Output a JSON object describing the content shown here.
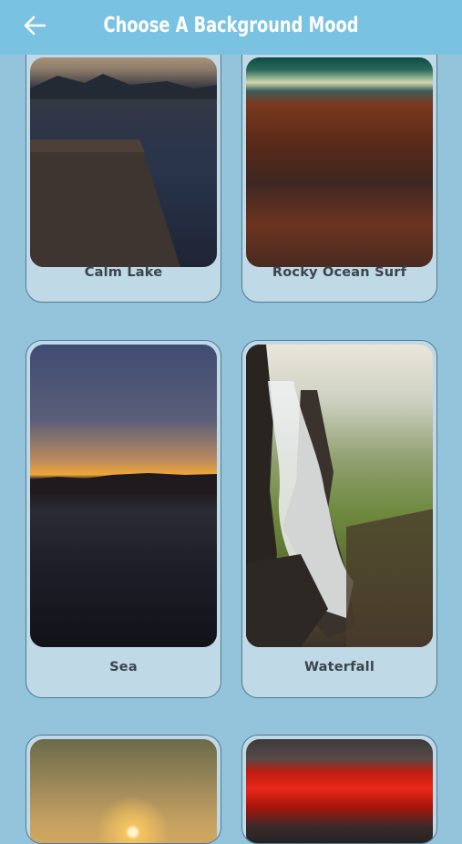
{
  "header": {
    "title": "Choose A Background Mood",
    "back_icon": "arrow-left-icon"
  },
  "moods": [
    {
      "label": "Calm Lake"
    },
    {
      "label": "Rocky Ocean Surf"
    },
    {
      "label": "Sea"
    },
    {
      "label": "Waterfall"
    },
    {
      "label": ""
    },
    {
      "label": ""
    }
  ],
  "colors": {
    "header": "#7ac2e2",
    "background": "#93c4dc",
    "card": "#c0d9e6",
    "card_border": "#4f7a90",
    "label_text": "#3b444c"
  }
}
